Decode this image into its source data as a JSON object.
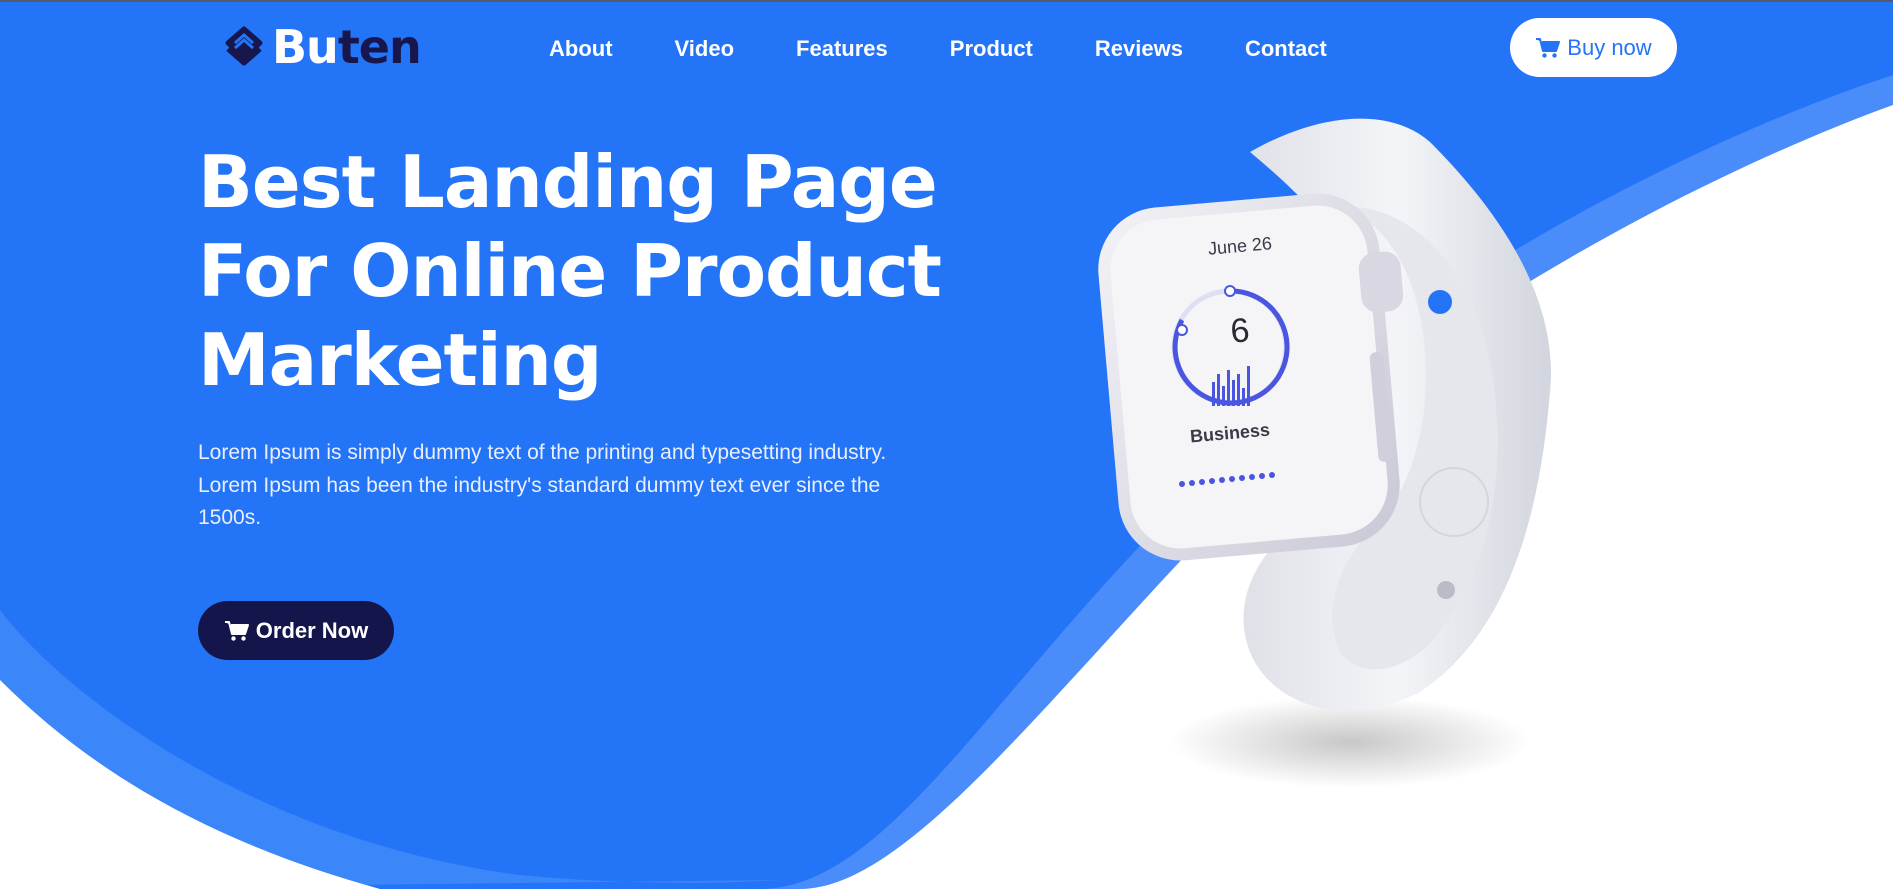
{
  "brand": {
    "name_part1": "Bu",
    "name_part2": "ten"
  },
  "nav": {
    "items": [
      {
        "label": "About"
      },
      {
        "label": "Video"
      },
      {
        "label": "Features"
      },
      {
        "label": "Product"
      },
      {
        "label": "Reviews"
      },
      {
        "label": "Contact"
      }
    ],
    "cta_label": "Buy now",
    "cta_icon": "cart-icon"
  },
  "hero": {
    "title_lines": [
      "Best Landing Page",
      "For Online Product",
      "Marketing"
    ],
    "description": "Lorem Ipsum is simply dummy text of the printing and typesetting industry. Lorem Ipsum has been the industry's standard dummy text ever since the 1500s.",
    "cta_label": "Order Now",
    "cta_icon": "cart-icon"
  },
  "watch_screen": {
    "date": "June 26",
    "value": "6",
    "label": "Business"
  },
  "colors": {
    "primary": "#2374f7",
    "wave_light": "#4a8cfa",
    "dark": "#14164b",
    "text_light": "#e9efff"
  }
}
